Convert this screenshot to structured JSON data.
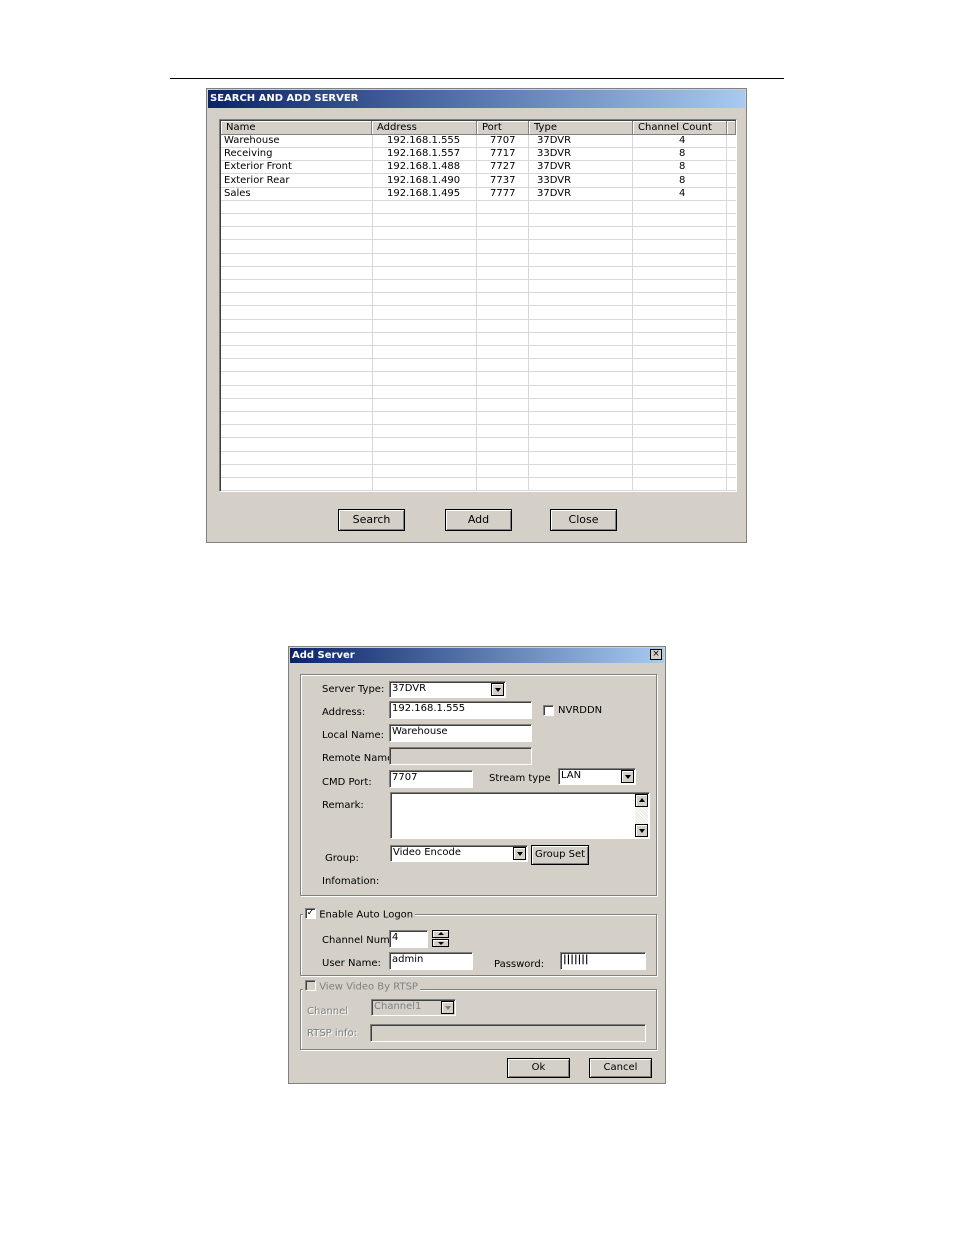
{
  "search_dialog": {
    "title": "SEARCH AND ADD SERVER",
    "columns": [
      "Name",
      "Address",
      "Port",
      "Type",
      "Channel Count"
    ],
    "rows": [
      [
        "Warehouse",
        "192.168.1.555",
        "7707",
        "37DVR",
        "4"
      ],
      [
        "Receiving",
        "192.168.1.557",
        "7717",
        "33DVR",
        "8"
      ],
      [
        "Exterior Front",
        "192.168.1.488",
        "7727",
        "37DVR",
        "8"
      ],
      [
        "Exterior Rear",
        "192.168.1.490",
        "7737",
        "33DVR",
        "8"
      ],
      [
        "Sales",
        "192.168.1.495",
        "7777",
        "37DVR",
        "4"
      ]
    ],
    "buttons": {
      "search": "Search",
      "add": "Add",
      "close": "Close"
    }
  },
  "add_server_dialog": {
    "title": "Add Server",
    "close_glyph": "×",
    "server_type": {
      "label": "Server Type:",
      "value": "37DVR"
    },
    "address": {
      "label": "Address:",
      "value": "192.168.1.555"
    },
    "nvrddns": {
      "label": "NVRDDN",
      "checked": false
    },
    "local_name": {
      "label": "Local Name:",
      "value": "Warehouse"
    },
    "remote_name": {
      "label": "Remote Name:",
      "value": ""
    },
    "cmd_port": {
      "label": "CMD Port:",
      "value": "7707"
    },
    "stream_type": {
      "label": "Stream type",
      "value": "LAN"
    },
    "remark": {
      "label": "Remark:",
      "value": ""
    },
    "group": {
      "label": "Group:",
      "value": "Video Encode",
      "button": "Group Set"
    },
    "information": {
      "label": "Infomation:"
    },
    "auto_logon": {
      "label": "Enable Auto Logon",
      "checked": true,
      "check_glyph": "✓"
    },
    "channel_num": {
      "label": "Channel Num:",
      "value": "4"
    },
    "user_name": {
      "label": "User Name:",
      "value": "admin"
    },
    "password": {
      "label": "Password:",
      "value": "|||||||"
    },
    "rtsp": {
      "label": "View Video By RTSP",
      "checked": false
    },
    "channel": {
      "label": "Channel",
      "value": "Channel1"
    },
    "rtsp_info": {
      "label": "RTSP info:",
      "value": ""
    },
    "ok_button": "Ok",
    "cancel_button": "Cancel"
  }
}
